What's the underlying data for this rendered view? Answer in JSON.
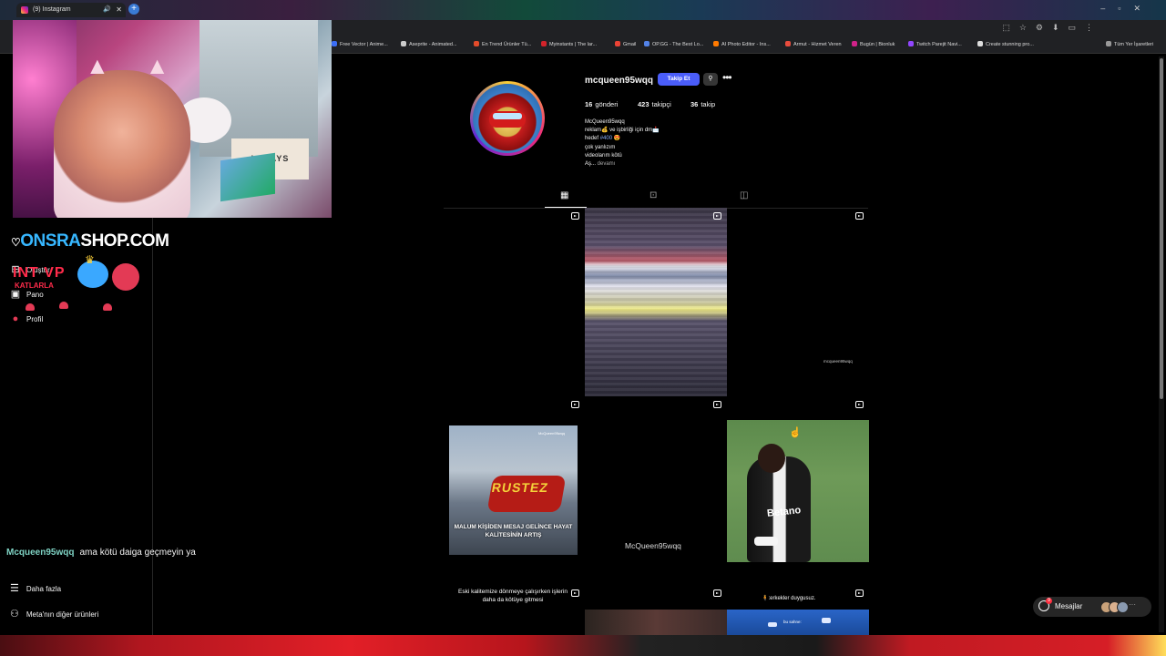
{
  "browser": {
    "tab_title": "(9) Instagram",
    "bookmarks": [
      {
        "label": "Free Vector | Anime...",
        "color": "#3b6ef6"
      },
      {
        "label": "Aseprite - Animated...",
        "color": "#cccccc"
      },
      {
        "label": "En Trend Ürünler Tü...",
        "color": "#e34b2a"
      },
      {
        "label": "Myinstants | The lar...",
        "color": "#d2232a"
      },
      {
        "label": "Gmail",
        "color": "#ea4335"
      },
      {
        "label": "OP.GG - The Best Lo...",
        "color": "#5383e8"
      },
      {
        "label": "AI Photo Editor - Ins...",
        "color": "#ff7a00"
      },
      {
        "label": "Armut - Hizmet Veren",
        "color": "#e84c3d"
      },
      {
        "label": "Bugün | Bionluk",
        "color": "#d1228a"
      },
      {
        "label": "Twitch Parejit Navi...",
        "color": "#9146ff"
      },
      {
        "label": "Create stunning pro...",
        "color": "#dddddd"
      },
      {
        "label": "Tüm Yer İşaretleri",
        "color": "#999999"
      }
    ]
  },
  "nav": {
    "items": [
      {
        "label": "Oluştur",
        "icon": "plus-square-icon"
      },
      {
        "label": "Pano",
        "icon": "dashboard-icon"
      },
      {
        "label": "Profil",
        "icon": "avatar-icon"
      }
    ],
    "more": "Daha fazla",
    "meta": "Meta'nın diğer ürünleri"
  },
  "overlay": {
    "shop_logo_a": "ONSRA",
    "shop_logo_b": "SHOP.COM",
    "intvp": "INT VP",
    "intvp_sub": "KATLARLA",
    "chat_user": "Mcqueen95wqq",
    "chat_message": "ama kötü daiga geçmeyin ya",
    "webcam_sign": "LOLAYS"
  },
  "profile": {
    "username": "mcqueen95wqq",
    "follow_label": "Takip Et",
    "stats": [
      {
        "value": "16",
        "label": "gönderi"
      },
      {
        "value": "423",
        "label": "takipçi"
      },
      {
        "value": "36",
        "label": "takip"
      }
    ],
    "bio": {
      "name": "McQueen95wqq",
      "line1": "reklam💰 ve işbirliği için dm📩",
      "line2_prefix": "hedef ",
      "line2_link": "#400",
      "line2_suffix": " 😍",
      "line3": "çok yanlızım",
      "line4": "videolarım kötü",
      "line5_prefix": "Aş... ",
      "line5_more": "devamı"
    }
  },
  "grid": {
    "post3_watermark": "mcqueen95wqq",
    "post4_brand": "RUSTEZ",
    "post4_caption": "MALUM KİŞİDEN MESAJ GELİNCE HAYAT KALİTESİNİN ARTIŞ",
    "post4_tag": "McQueen95wqq",
    "post5_label": "McQueen95wqq",
    "post6_sponsor": "Betano",
    "post7_caption": "Eski kalitemize dönmeye çalışırken işlerin daha da kötüye gitmesi",
    "post9_caption": "🧍:erkekler duygusuz.",
    "post9_tag": "bu sahne:"
  },
  "messages": {
    "label": "Mesajlar",
    "badge": "9"
  }
}
